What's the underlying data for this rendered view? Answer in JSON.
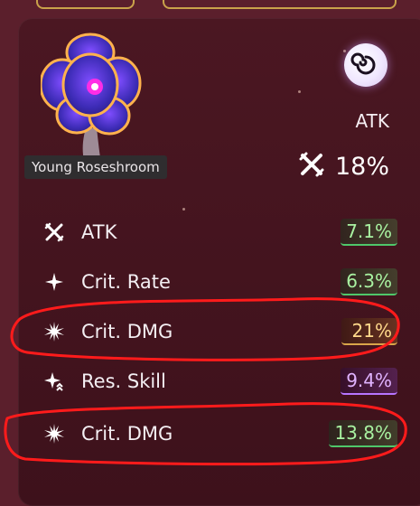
{
  "item": {
    "name": "Young Roseshroom",
    "art_icon": "flower-art-icon",
    "set_icon": "spiral-icon"
  },
  "main_stat": {
    "name": "ATK",
    "value": "18%",
    "icon": "crossed-swords-icon"
  },
  "substats": [
    {
      "name": "ATK",
      "value": "7.1%",
      "icon": "crossed-swords-icon",
      "tone": "green"
    },
    {
      "name": "Crit. Rate",
      "value": "6.3%",
      "icon": "sparkle-star-icon",
      "tone": "green"
    },
    {
      "name": "Crit. DMG",
      "value": "21%",
      "icon": "burst-icon",
      "tone": "gold"
    },
    {
      "name": "Res. Skill",
      "value": "9.4%",
      "icon": "res-skill-icon",
      "tone": "purple"
    },
    {
      "name": "Crit. DMG",
      "value": "13.8%",
      "icon": "burst-icon",
      "tone": "green"
    }
  ],
  "colors": {
    "green": "#4fc76a",
    "gold": "#d9a54a",
    "purple": "#b775ff",
    "annotation": "#ff1b1b"
  }
}
